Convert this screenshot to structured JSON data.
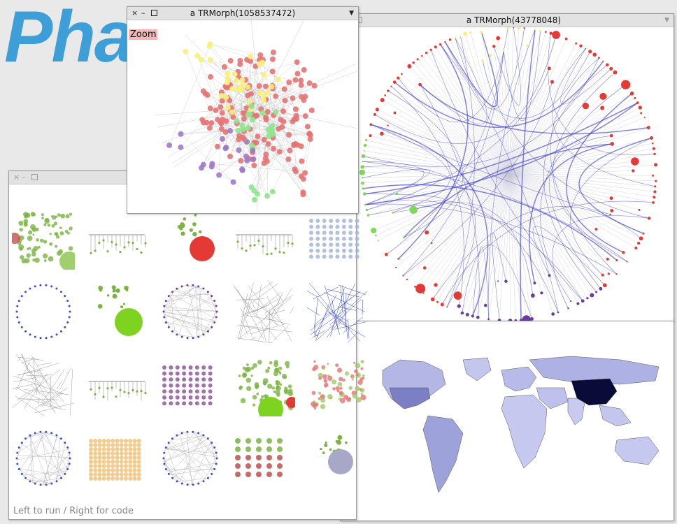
{
  "logo": {
    "text": "Pha"
  },
  "window_a": {
    "title": "a TRMorph(1058537472)",
    "zoom_label": "Zoom"
  },
  "window_b": {
    "title": "a TRMorph(43778048)"
  },
  "gallery": {
    "hint": "Left to run / Right for code"
  },
  "colors": {
    "red": "#e57373",
    "yellow": "#f7f07a",
    "green": "#8ee58e",
    "purple": "#a079c8",
    "blue_edge": "#3333cc",
    "logo_blue": "#3e9fd8"
  },
  "icons": {
    "close": "×",
    "minimize": "–",
    "menu": "▼"
  },
  "map": {
    "highlight_country": "China"
  }
}
